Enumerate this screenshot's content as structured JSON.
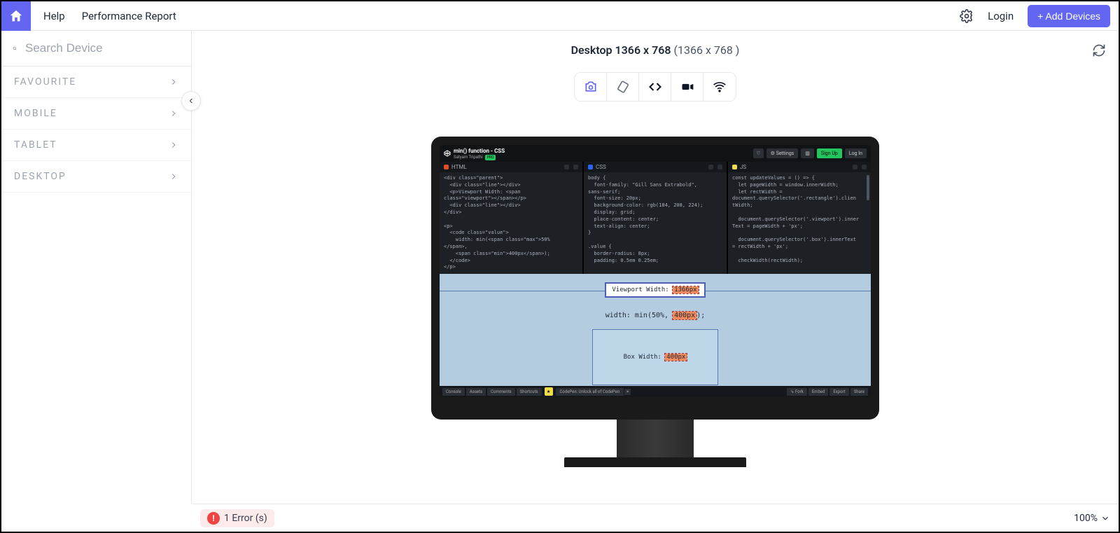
{
  "header": {
    "help": "Help",
    "perf": "Performance Report",
    "login": "Login",
    "add_devices": "+ Add Devices"
  },
  "sidebar": {
    "search_placeholder": "Search Device",
    "categories": [
      "FAVOURITE",
      "MOBILE",
      "TABLET",
      "DESKTOP"
    ]
  },
  "device": {
    "name": "Desktop 1366 x 768",
    "dims": "(1366 x 768 )"
  },
  "bottom": {
    "errors": "1 Error (s)",
    "zoom": "100%"
  },
  "codepen": {
    "title": "min() function - CSS",
    "author": "Satyam Tripathi",
    "pro": "PRO",
    "settings": "Settings",
    "signup": "Sign Up",
    "login": "Log In",
    "panes": {
      "html": "HTML",
      "css": "CSS",
      "js": "JS"
    },
    "preview": {
      "vw_label": "Viewport Width:",
      "vw_value": "1366px",
      "width_line_a": "width: min(50%, ",
      "width_line_b": "400px",
      "width_line_c": ");",
      "box_label": "Box Width:",
      "box_value": "400px"
    },
    "footer": {
      "console": "Console",
      "assets": "Assets",
      "comments": "Comments",
      "shortcuts": "Shortcuts",
      "promo": "CodePen: Unlock all of CodePen",
      "fork": "Fork",
      "embed": "Embed",
      "export": "Export",
      "share": "Share"
    },
    "code": {
      "html": "<div class=\"parent\">\n  <div class=\"line\"></div>\n  <p>Viewport Width: <span\nclass=\"viewport\"></span></p>\n  <div class=\"line\"></div>\n</div>\n\n<p>\n  <code class=\"value\">\n    width: min(<span class=\"max\">50%\n</span>,\n    <span class=\"min\">400px</span>);\n  </code>\n</p>",
      "css": "body {\n  font-family: \"Gill Sans Extrabold\",\nsans-serif;\n  font-size: 20px;\n  background-color: rgb(184, 208, 224);\n  display: grid;\n  place-content: center;\n  text-align: center;\n}\n\n.value {\n  border-radius: 8px;\n  padding: 0.5em 0.25em;",
      "js": "const updateValues = () => {\n  let pageWidth = window.innerWidth;\n  let rectWidth =\ndocument.querySelector('.rectangle').clien\ntWidth;\n\n  document.querySelector('.viewport').inner\nText = pageWidth + 'px';\n\n  document.querySelector('.box').innerText\n= rectWidth + 'px';\n\n  checkWidth(rectWidth);"
    }
  }
}
